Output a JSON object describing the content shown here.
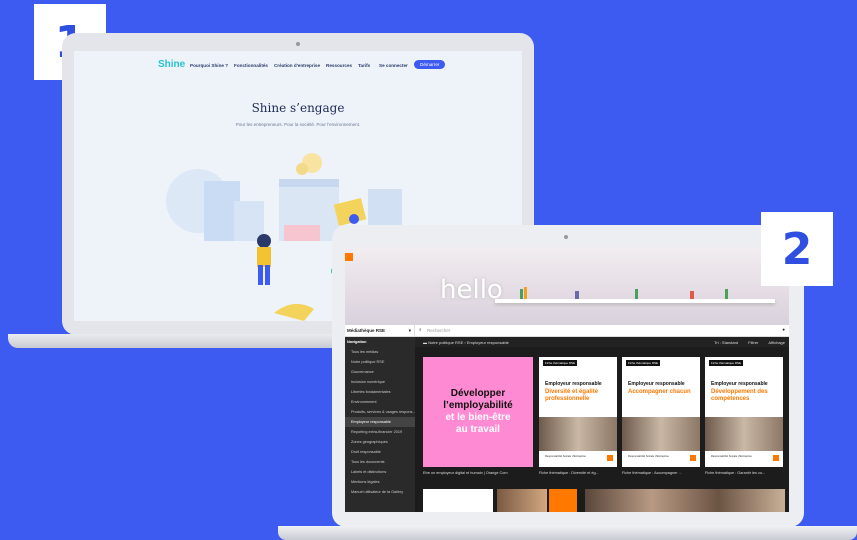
{
  "badges": {
    "one": "1",
    "two": "2"
  },
  "shine": {
    "logo": "Shine",
    "nav": [
      "Pourquoi Shine ?",
      "Fonctionnalités",
      "Création d'entreprise",
      "Ressources",
      "Tarifs"
    ],
    "login": "Se connecter",
    "cta": "Démarrer",
    "hero_title": "Shine s’engage",
    "hero_subtitle": "Pour les entrepreneurs. Pour la société. Pour l’environnement."
  },
  "mediatheque": {
    "hello_word": "hello",
    "lang": "FR",
    "selector": "Médiathèque RSE",
    "search_placeholder": "Rechercher",
    "breadcrumb": [
      "Notre politique RSE",
      "Employeur responsable"
    ],
    "toolbar": {
      "sort": "Tri : Standard",
      "filter": "Filtrer",
      "view": "Affichage"
    },
    "sidebar": {
      "title": "Navigation",
      "items": [
        "Tous les médias",
        "Notre politique RSE",
        "Gouvernance",
        "Inclusion numérique",
        "Libertés fondamentales",
        "Environnement",
        "Produits, services & usages respons...",
        "Employeur responsable",
        "Reporting extra-financier 2019",
        "Zones géographiques",
        "Droit responsable",
        "Tous les documents",
        "Labels et distinctions",
        "Mentions légales",
        "Manuel utilisateur de la Gallery"
      ],
      "active_index": 7
    },
    "hero_card": {
      "line1": "Développer",
      "line2": "l’employabilité",
      "line3": "et le bien-être",
      "line4": "au travail"
    },
    "cards": [
      {
        "tag": "Fiche thématique RSE",
        "title": "Employeur responsable",
        "subtitle": "Diversité et égalité professionnelle",
        "footer": "Responsabilité Sociale d’Entreprise"
      },
      {
        "tag": "Fiche thématique RSE",
        "title": "Employeur responsable",
        "subtitle": "Accompagner chacun",
        "footer": "Responsabilité Sociale d’Entreprise"
      },
      {
        "tag": "Fiche thématique RSE",
        "title": "Employeur responsable",
        "subtitle": "Développement des compétences",
        "footer": "Responsabilité Sociale d’Entreprise"
      }
    ],
    "captions": [
      "Etre un employeur digital et humain | Orange Com",
      "Fiche thématique : Diversité et ég...",
      "Fiche thématique : Accompagner ...",
      "Fiche thématique : Garantir les co..."
    ]
  },
  "colors": {
    "background": "#3d5af1",
    "accent_orange": "#ff7900",
    "hero_pink": "#ff8ad4"
  }
}
